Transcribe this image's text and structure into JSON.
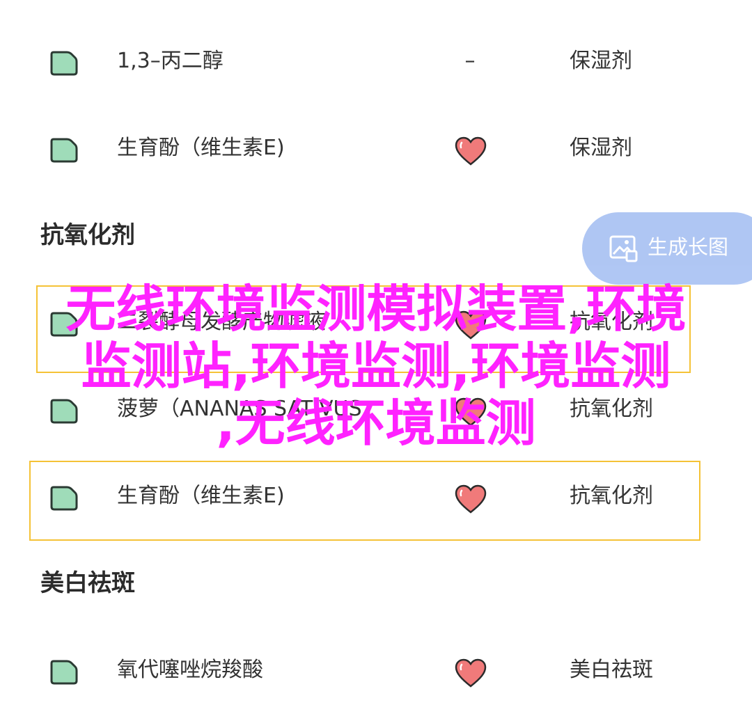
{
  "rows_top": [
    {
      "name": "1,3–丙二醇",
      "rating": "–",
      "function": "保湿剂"
    },
    {
      "name": "生育酚（维生素E)",
      "rating": "heart-icon",
      "function": "保湿剂"
    }
  ],
  "section_antioxidant": {
    "title": "抗氧化剂"
  },
  "rows_middle": [
    {
      "name": "二裂酵母发酵产物滤液",
      "function": "抗氧化剂"
    },
    {
      "name": "菠萝（ANANAS SATIVUS",
      "function": "抗氧化剂"
    },
    {
      "name": "生育酚（维生素E)",
      "function": "抗氧化剂"
    }
  ],
  "section_whitening": {
    "title": "美白祛斑"
  },
  "rows_bottom": [
    {
      "name": "氧代噻唑烷羧酸",
      "function": "美白祛斑"
    }
  ],
  "fab": {
    "label": "生成长图",
    "icon": "image-icon"
  },
  "overlay_text": {
    "line1": "无线环境监测模拟装置,环境",
    "line2": "监测站,环境监测,环境监测",
    "line3": ",无线环境监测"
  },
  "colors": {
    "tag_fill": "#9fdcb9",
    "tag_stroke": "#2b3a33",
    "heart_fill": "#f07a7a",
    "highlight_border": "#f5c236",
    "overlay": "#ff22ff",
    "fab_bg": "#a9c2f3"
  }
}
